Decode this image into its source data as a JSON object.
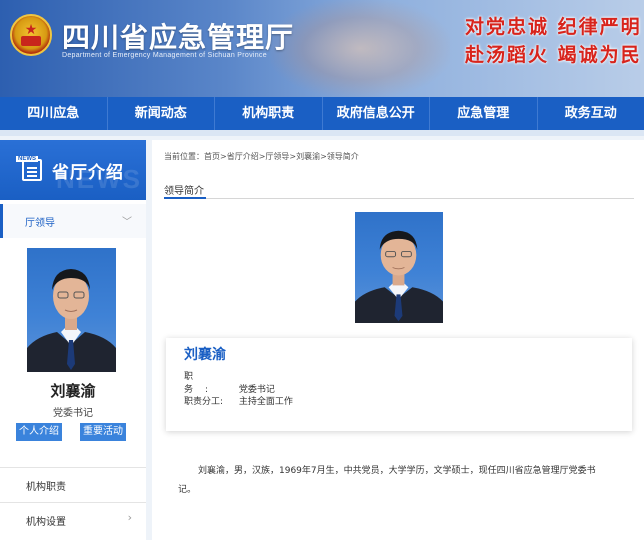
{
  "header": {
    "site_title": "四川省应急管理厅",
    "site_subtitle": "Department of Emergency Management of Sichuan Province",
    "slogan_line1": "对党忠诚 纪律严明",
    "slogan_line2": "赴汤蹈火 竭诚为民",
    "emblem_icon": "national-emblem-icon"
  },
  "nav": {
    "items": [
      {
        "label": "四川应急"
      },
      {
        "label": "新闻动态"
      },
      {
        "label": "机构职责"
      },
      {
        "label": "政府信息公开"
      },
      {
        "label": "应急管理"
      },
      {
        "label": "政务互动"
      }
    ]
  },
  "sidebar": {
    "title": "省厅介绍",
    "title_icon_tag": "NEWS",
    "ghost_text": "NEWS",
    "sub_label": "厅领导",
    "person_name": "刘襄渝",
    "person_post": "党委书记",
    "button_intro": "个人介绍",
    "button_activity": "重要活动",
    "links": [
      {
        "label": "机构职责"
      },
      {
        "label": "机构设置"
      }
    ]
  },
  "main": {
    "breadcrumb": "当前位置：首页>省厅介绍>厅领导>刘襄渝>领导简介",
    "section_title": "领导简介",
    "card": {
      "name": "刘襄渝",
      "post_key": "职务:",
      "post_value": "党委书记",
      "duty_key": "职责分工:",
      "duty_value": "主持全面工作"
    },
    "bio": "刘襄渝，男，汉族，1969年7月生，中共党员，大学学历，文学硕士，现任四川省应急管理厅党委书记。"
  },
  "colors": {
    "primary": "#1a5fc4",
    "slogan": "#d8241c",
    "photo_background": "#3f82d6"
  }
}
